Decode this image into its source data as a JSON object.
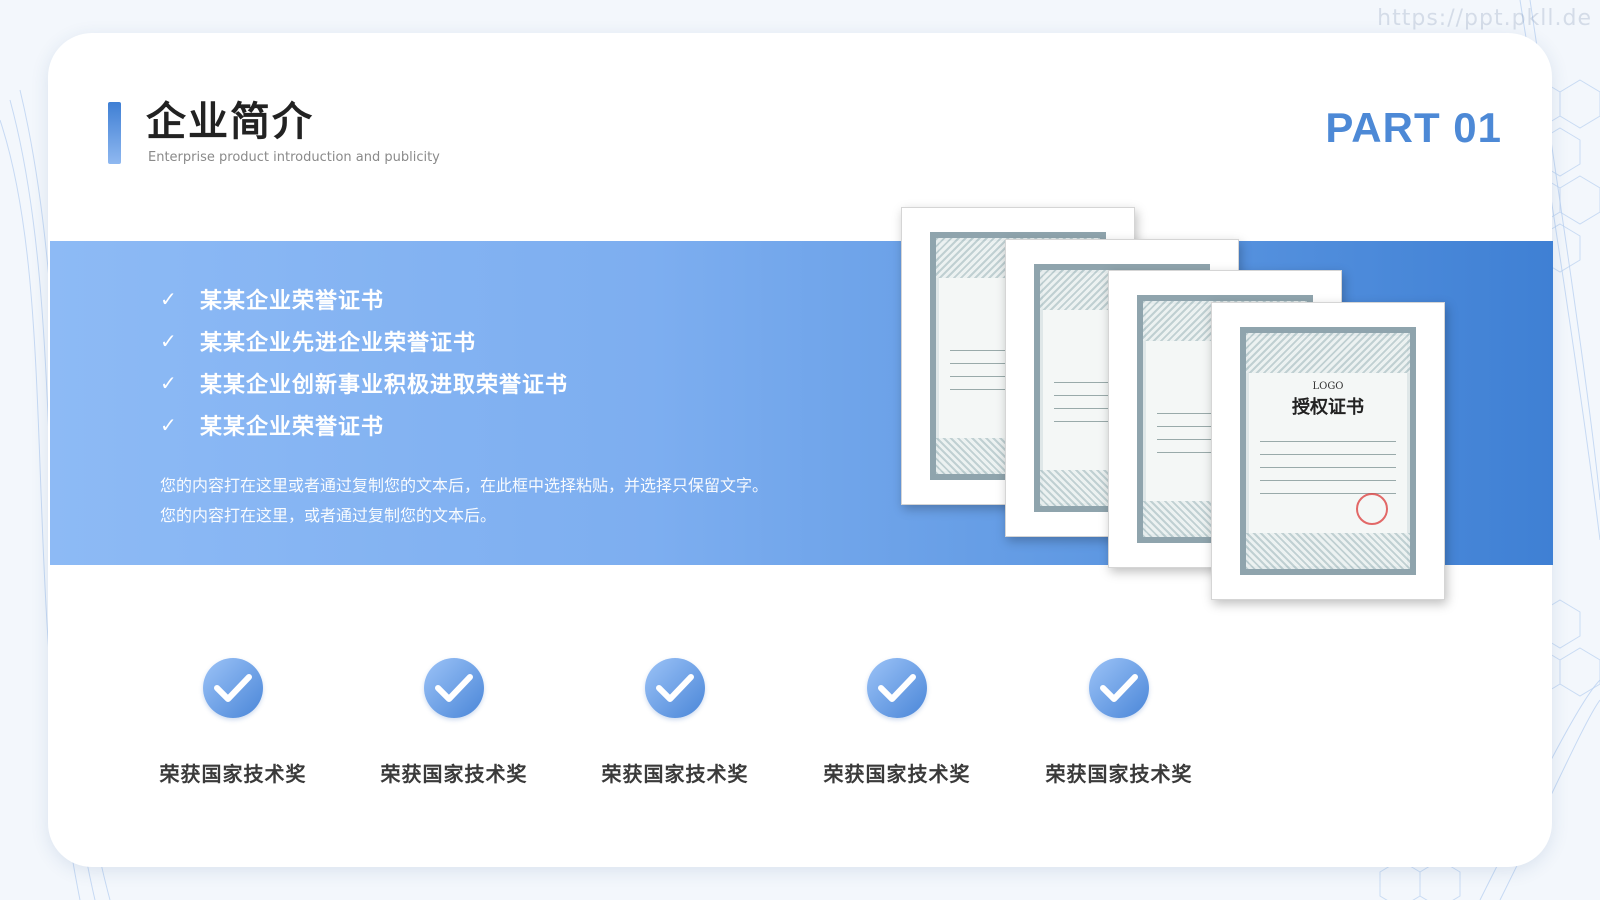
{
  "watermark": "https://ppt.pkll.de",
  "header": {
    "title": "企业简介",
    "subtitle": "Enterprise product introduction and publicity",
    "part": "PART 01"
  },
  "band": {
    "bullets": [
      "某某企业荣誉证书",
      "某某企业先进企业荣誉证书",
      "某某企业创新事业积极进取荣誉证书",
      "某某企业荣誉证书"
    ],
    "description_lines": [
      "您的内容打在这里或者通过复制您的文本后，在此框中选择粘贴，并选择只保留文字。",
      "您的内容打在这里，或者通过复制您的文本后。"
    ]
  },
  "certificate": {
    "logo": "LOGO",
    "title": "授权证书"
  },
  "awards": [
    {
      "label": "荣获国家技术奖"
    },
    {
      "label": "荣获国家技术奖"
    },
    {
      "label": "荣获国家技术奖"
    },
    {
      "label": "荣获国家技术奖"
    },
    {
      "label": "荣获国家技术奖"
    }
  ],
  "colors": {
    "accent": "#4d89d6",
    "band_start": "#8dbaf5",
    "band_end": "#3f80d4"
  }
}
